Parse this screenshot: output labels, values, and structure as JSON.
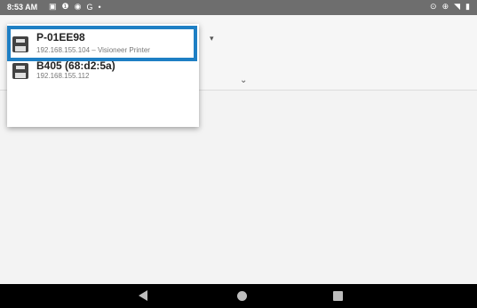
{
  "status_bar": {
    "time": "8:53 AM",
    "left_icons": [
      "image-icon",
      "info-icon",
      "location-icon",
      "google-icon",
      "dot-icon"
    ],
    "left_glyphs": [
      "▣",
      "❶",
      "◉",
      "G",
      "•"
    ],
    "right_icons": [
      "location-pin-icon",
      "vibrate-icon",
      "wifi-icon",
      "battery-icon"
    ],
    "right_glyphs": [
      "⊙",
      "⊕",
      "◥",
      "▮"
    ]
  },
  "app_bar": {
    "top_caret": "▾",
    "bottom_caret": "⌄"
  },
  "printers": [
    {
      "name": "P-01EE98",
      "detail": "192.168.155.104 – Visioneer Printer",
      "selected": true
    },
    {
      "name": "B405 (68:d2:5a)",
      "detail": "192.168.155.112",
      "selected": false
    }
  ],
  "nav_bar": {
    "icons": [
      "back-icon",
      "home-icon",
      "recents-icon"
    ]
  },
  "colors": {
    "status_bar": "#6e6e6e",
    "highlight": "#1e7fc4",
    "nav_bar": "#000000"
  }
}
